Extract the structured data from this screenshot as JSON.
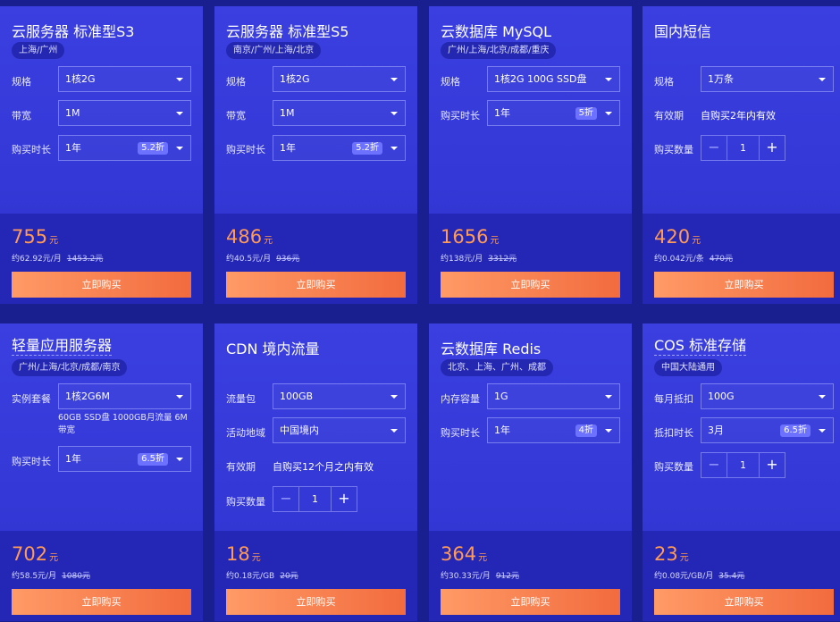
{
  "cards": [
    {
      "title": "云服务器 标准型S3",
      "region": "上海/广州",
      "spec_label": "规格",
      "spec_value": "1核2G",
      "bw_label": "带宽",
      "bw_value": "1M",
      "dur_label": "购买时长",
      "dur_value": "1年",
      "dur_discount": "5.2折",
      "price": "755",
      "unit": "元",
      "monthly": "约62.92元/月",
      "original": "1453.2元",
      "buy_label": "立即购买"
    },
    {
      "title": "云服务器 标准型S5",
      "region": "南京/广州/上海/北京",
      "spec_label": "规格",
      "spec_value": "1核2G",
      "bw_label": "带宽",
      "bw_value": "1M",
      "dur_label": "购买时长",
      "dur_value": "1年",
      "dur_discount": "5.2折",
      "price": "486",
      "unit": "元",
      "monthly": "约40.5元/月",
      "original": "936元",
      "buy_label": "立即购买"
    },
    {
      "title": "云数据库 MySQL",
      "region": "广州/上海/北京/成都/重庆",
      "spec_label": "规格",
      "spec_value": "1核2G 100G SSD盘",
      "dur_label": "购买时长",
      "dur_value": "1年",
      "dur_discount": "5折",
      "price": "1656",
      "unit": "元",
      "monthly": "约138元/月",
      "original": "3312元",
      "buy_label": "立即购买"
    },
    {
      "title": "国内短信",
      "spec_label": "规格",
      "spec_value": "1万条",
      "valid_label": "有效期",
      "valid_value": "自购买2年内有效",
      "qty_label": "购买数量",
      "qty_value": "1",
      "minus": "−",
      "plus": "+",
      "price": "420",
      "unit": "元",
      "monthly": "约0.042元/条",
      "original": "470元",
      "buy_label": "立即购买"
    },
    {
      "title": "轻量应用服务器",
      "region": "广州/上海/北京/成都/南京",
      "spec_label": "实例套餐",
      "spec_value": "1核2G6M",
      "note": "60GB SSD盘 1000GB月流量 6M带宽",
      "dur_label": "购买时长",
      "dur_value": "1年",
      "dur_discount": "6.5折",
      "price": "702",
      "unit": "元",
      "monthly": "约58.5元/月",
      "original": "1080元",
      "buy_label": "立即购买"
    },
    {
      "title": "CDN 境内流量",
      "spec_label": "流量包",
      "spec_value": "100GB",
      "area_label": "活动地域",
      "area_value": "中国境内",
      "valid_label": "有效期",
      "valid_value": "自购买12个月之内有效",
      "qty_label": "购买数量",
      "qty_value": "1",
      "minus": "−",
      "plus": "+",
      "price": "18",
      "unit": "元",
      "monthly": "约0.18元/GB",
      "original": "20元",
      "buy_label": "立即购买"
    },
    {
      "title": "云数据库 Redis",
      "region": "北京、上海、广州、成都",
      "spec_label": "内存容量",
      "spec_value": "1G",
      "dur_label": "购买时长",
      "dur_value": "1年",
      "dur_discount": "4折",
      "price": "364",
      "unit": "元",
      "monthly": "约30.33元/月",
      "original": "912元",
      "buy_label": "立即购买"
    },
    {
      "title": "COS 标准存储",
      "region": "中国大陆通用",
      "spec_label": "每月抵扣",
      "spec_value": "100G",
      "dur_label": "抵扣时长",
      "dur_value": "3月",
      "dur_discount": "6.5折",
      "qty_label": "购买数量",
      "qty_value": "1",
      "minus": "−",
      "plus": "+",
      "price": "23",
      "unit": "元",
      "monthly": "约0.08元/GB/月",
      "original": "35.4元",
      "buy_label": "立即购买"
    }
  ]
}
